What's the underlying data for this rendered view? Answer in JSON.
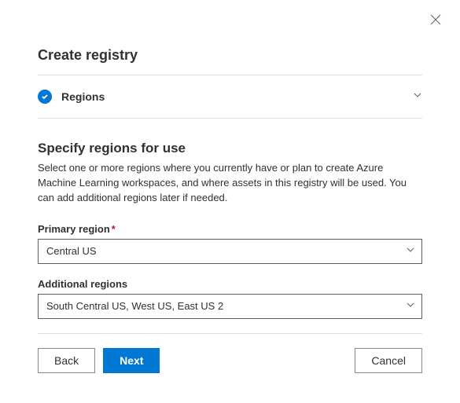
{
  "title": "Create registry",
  "step": {
    "label": "Regions"
  },
  "form": {
    "heading": "Specify regions for use",
    "description": "Select one or more regions where you currently have or plan to create Azure Machine Learning workspaces, and where assets in this registry will be used. You can add additional regions later if needed.",
    "primary": {
      "label": "Primary region",
      "value": "Central US"
    },
    "additional": {
      "label": "Additional regions",
      "value": "South Central US, West US, East US 2"
    }
  },
  "buttons": {
    "back": "Back",
    "next": "Next",
    "cancel": "Cancel"
  }
}
